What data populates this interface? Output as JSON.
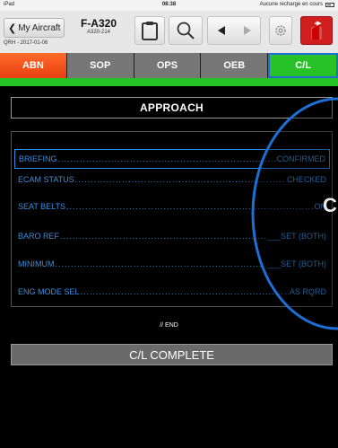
{
  "status_bar": {
    "device": "iPad",
    "time": "08:38",
    "battery_text": "Aucune recharge en cours"
  },
  "header": {
    "back_label": "My Aircraft",
    "qrh_date": "QRH - 2017-01-06",
    "aircraft": "F-A320",
    "aircraft_sub": "A320-214",
    "icons": [
      "clipboard-icon",
      "search-icon",
      "back-triangle-icon",
      "forward-triangle-icon",
      "gear-icon",
      "exit-door-icon"
    ]
  },
  "tabs": [
    {
      "label": "ABN",
      "color": "#f05a1e"
    },
    {
      "label": "SOP",
      "color": "#777777"
    },
    {
      "label": "OPS",
      "color": "#777777"
    },
    {
      "label": "OEB",
      "color": "#777777"
    },
    {
      "label": "C/L",
      "color": "#27c227",
      "active": true
    }
  ],
  "checklist": {
    "title": "APPROACH",
    "items": [
      {
        "item": "BRIEFING",
        "value": "CONFIRMED",
        "selected": true
      },
      {
        "item": "ECAM STATUS",
        "value": "CHECKED"
      },
      {
        "item": "SEAT BELTS",
        "value": "ON"
      },
      {
        "item": "BARO REF",
        "value": "___SET (BOTH)"
      },
      {
        "item": "MINIMUM",
        "value": "___SET (BOTH)"
      },
      {
        "item": "ENG MODE SEL",
        "value": "AS RQRD"
      }
    ],
    "end_label": "// END",
    "complete_label": "C/L COMPLETE"
  },
  "overlay": {
    "partial_label": "C"
  },
  "colors": {
    "item_text": "#3b8ee0",
    "accent_green": "#22c322",
    "accent_orange": "#f05a1e",
    "selection_blue": "#2b8fe8"
  }
}
